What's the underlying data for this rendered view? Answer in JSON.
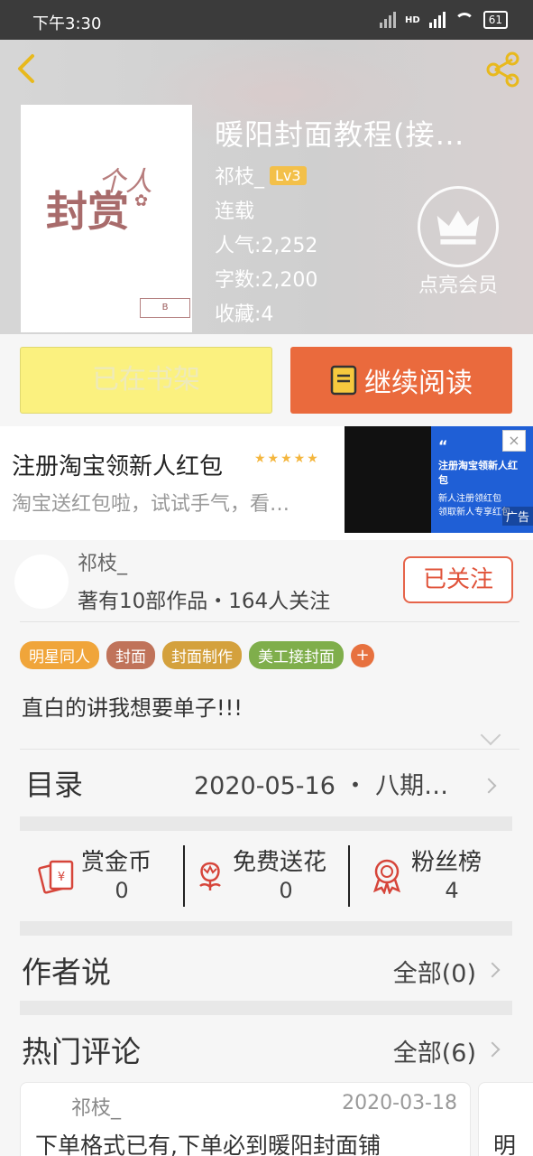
{
  "status_bar": {
    "time": "下午3:30",
    "network": "HD",
    "battery": "61"
  },
  "book": {
    "title": "暖阳封面教程(接…",
    "author": "祁枝_",
    "level": "Lv3",
    "status": "连载",
    "popularity": "人气:2,252",
    "word_count": "字数:2,200",
    "favorites": "收藏:4",
    "vip_label": "点亮会员",
    "cover_text_line1": "个人",
    "cover_text_line2": "封赏"
  },
  "actions": {
    "shelf_label": "已在书架",
    "read_label": "继续阅读"
  },
  "ad": {
    "title": "注册淘宝领新人红包",
    "subtitle": "淘宝送红包啦，试试手气，看…",
    "image_title": "注册淘宝领新人红包",
    "image_line1": "新人注册领红包",
    "image_line2": "领取新人专享红包",
    "ad_tag": "广告",
    "close_label": "×",
    "stars": "★★★★★"
  },
  "author_card": {
    "name": "祁枝_",
    "stats": "著有10部作品・164人关注",
    "follow_label": "已关注"
  },
  "tags": [
    {
      "label": "明星同人",
      "color": "#f0a53a"
    },
    {
      "label": "封面",
      "color": "#c0735a"
    },
    {
      "label": "封面制作",
      "color": "#d4a13d"
    },
    {
      "label": "美工接封面",
      "color": "#7fae4b"
    }
  ],
  "tag_add_label": "+",
  "description": "直白的讲我想要单子!!!",
  "toc": {
    "label": "目录",
    "latest": "2020-05-16 ・ 八期…"
  },
  "stats": [
    {
      "label": "赏金币",
      "value": "0",
      "icon": "red-envelope-icon"
    },
    {
      "label": "免费送花",
      "value": "0",
      "icon": "flower-icon"
    },
    {
      "label": "粉丝榜",
      "value": "4",
      "icon": "medal-icon"
    }
  ],
  "author_says": {
    "label": "作者说",
    "all": "全部(0)"
  },
  "hot_comments": {
    "label": "热门评论",
    "all": "全部(6)"
  },
  "comments": [
    {
      "user": "祁枝_",
      "date": "2020-03-18",
      "text": "下单格式已有,下单必到暖阳封面铺"
    },
    {
      "user": "",
      "date": "",
      "text": "明"
    }
  ],
  "colors": {
    "accent": "#ea6a3d",
    "shelf": "#fbf17f",
    "follow": "#e0533a"
  }
}
